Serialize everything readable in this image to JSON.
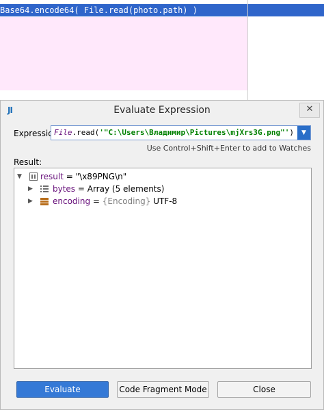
{
  "editor": {
    "code_line": "Base64.encode64( File.read(photo.path) )"
  },
  "dialog": {
    "app_logo": "JI",
    "title": "Evaluate Expression",
    "close_glyph": "✕",
    "expression_label": "Expression:",
    "expression_prefix": "File",
    "expression_mid": ".read(",
    "expression_string": "'\"C:\\Users\\Владимир\\Pictures\\mjXrs3G.png\"'",
    "expression_suffix": ")",
    "combo_arrow": "▼",
    "hint": "Use Control+Shift+Enter to add to Watches",
    "result_label": "Result:",
    "tree": {
      "root": {
        "name": "result",
        "op": " = ",
        "value": "\"\\x89PNG\\n\""
      },
      "children": [
        {
          "name": "bytes",
          "op": " = ",
          "type": "",
          "value": "Array (5 elements)"
        },
        {
          "name": "encoding",
          "op": " = ",
          "type": "{Encoding}",
          "value": " UTF-8"
        }
      ]
    },
    "buttons": {
      "evaluate": "Evaluate",
      "code_fragment": "Code Fragment Mode",
      "close": "Close"
    }
  },
  "colors": {
    "selection": "#2f65ca",
    "pink_bg": "#ffe8fb",
    "primary_button": "#3579d6",
    "field_name": "#660e7a"
  }
}
